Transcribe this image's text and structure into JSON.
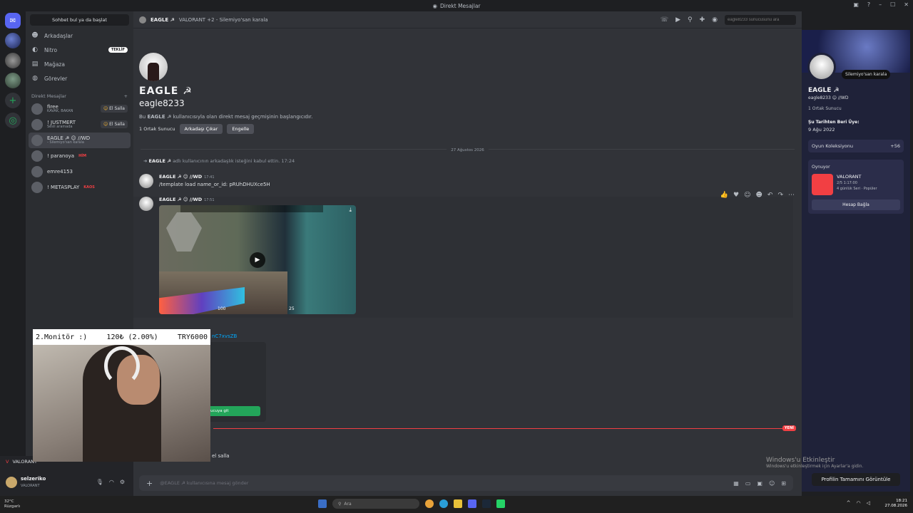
{
  "window": {
    "title": "Direkt Mesajlar"
  },
  "sidebar": {
    "search_label": "Sohbet bul ya da başlat",
    "nav": [
      {
        "label": "Arkadaşlar",
        "icon": "friends-icon"
      },
      {
        "label": "Nitro",
        "icon": "nitro-icon",
        "badge": "TEKLİF"
      },
      {
        "label": "Mağaza",
        "icon": "shop-icon"
      },
      {
        "label": "Görevler",
        "icon": "quests-icon"
      }
    ],
    "dm_header": "Direkt Mesajlar",
    "dm_add": "+",
    "dms": [
      {
        "name": "firee",
        "sub": "KAVAK, BAKAN",
        "wave": "El Salla"
      },
      {
        "name": "! JUSTMERT",
        "sub": "Sesli aramada",
        "wave": "El Salla"
      },
      {
        "name": "EAGLE ☭ ☺ //WD",
        "sub": "- Silemiyo'san karala"
      },
      {
        "name": "! paranoya",
        "tag": "HİM"
      },
      {
        "name": "emre4153"
      },
      {
        "name": "! METASPLAY",
        "tag": "KAOS"
      }
    ]
  },
  "header": {
    "dm_name": "EAGLE ☭",
    "activity": "VALORANT +2 - Silemiyo'san karala",
    "search_placeholder": "eagle8233 sunucusunu ara"
  },
  "intro": {
    "display_name": "EAGLE ☭",
    "username": "eagle8233",
    "text_pre": "Bu ",
    "text_bold": "EAGLE ☭",
    "text_post": " kullanıcısıyla olan direkt mesaj geçmişinin başlangıcıdır.",
    "mutual": "1 Ortak Sunucu",
    "remove_friend": "Arkadaşı Çıkar",
    "block": "Engelle"
  },
  "messages": {
    "date": "27 Ağustos 2026",
    "system_user": "EAGLE ☭",
    "system_text": " adlı kullanıcının arkadaşlık isteğini kabul ettin.",
    "system_time": "17:24",
    "author": "EAGLE ☭ ☺ //WD",
    "msg1_time": "17:41",
    "msg1_text": "/template load name_or_id: pRUhDHUXce5H",
    "msg2_time": "17:51",
    "video_hud_left": "100",
    "video_hud_right": "25",
    "partial_link": "nC7xvsZB",
    "card_button": "ucuya git",
    "new_label": "YENİ",
    "wave_label": "el salla"
  },
  "input": {
    "placeholder": "@EAGLE ☭ kullanıcısına mesaj gönder"
  },
  "profile": {
    "status": "Silemiyo'san karala",
    "display_name": "EAGLE ☭",
    "username": "eagle8233 ☺ //WD",
    "mutual": "1 Ortak Sunucu",
    "member_since_label": "Şu Tarihten Beri Üye:",
    "member_since": "9 Ağu 2022",
    "games_label": "Oyun Koleksiyonu",
    "games_count": "+56",
    "playing_label": "Oynuyor",
    "game_name": "VALORANT",
    "game_detail1": "2/5  1:17:00",
    "game_detail2": "4 günlük Seri · Popüler",
    "connect_button": "Hesap Bağla",
    "full_profile": "Profilin Tamamını Görüntüle"
  },
  "watermark": {
    "line1": "Windows'u Etkinleştir",
    "line2": "Windows'u etkinleştirmek için Ayarlar'a gidin."
  },
  "userpanel": {
    "game": "VALORANT",
    "name": "selzeriko",
    "status": "VALORANT"
  },
  "overlay": {
    "monitor": "2.Monitör :)",
    "amount": "120₺ (2.00%)",
    "goal": "TRY6000"
  },
  "taskbar": {
    "temp": "32°C",
    "weather": "Rüzgarlı",
    "search": "Ara",
    "time": "18:21",
    "date": "27.08.2026"
  },
  "colors": {
    "accent": "#5865f2",
    "green": "#23a55a",
    "red": "#f23f43"
  }
}
